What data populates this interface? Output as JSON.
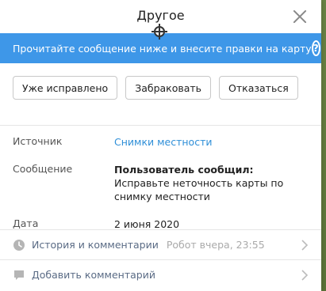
{
  "dialog": {
    "title": "Другое",
    "banner": "Прочитайте сообщение ниже и внесите правки на карту"
  },
  "actions": {
    "fixed_label": "Уже исправлено",
    "reject_label": "Забраковать",
    "decline_label": "Отказаться"
  },
  "fields": {
    "source_label": "Источник",
    "source_value": "Снимки местности",
    "message_label": "Сообщение",
    "message_title": "Пользователь сообщил:",
    "message_body": "Исправьте неточность карты по снимку местности",
    "date_label": "Дата",
    "date_value": "2 июня 2020"
  },
  "footer": {
    "history_label": "История и комментарии",
    "history_meta": "Робот вчера, 23:55",
    "add_comment_label": "Добавить комментарий"
  },
  "icons": {
    "close": "close-icon",
    "help": "help-icon",
    "history": "clock-icon",
    "comment": "comment-icon",
    "chevron": "chevron-right-icon"
  },
  "colors": {
    "banner": "#3e97e8",
    "link": "#2f8fd8"
  }
}
